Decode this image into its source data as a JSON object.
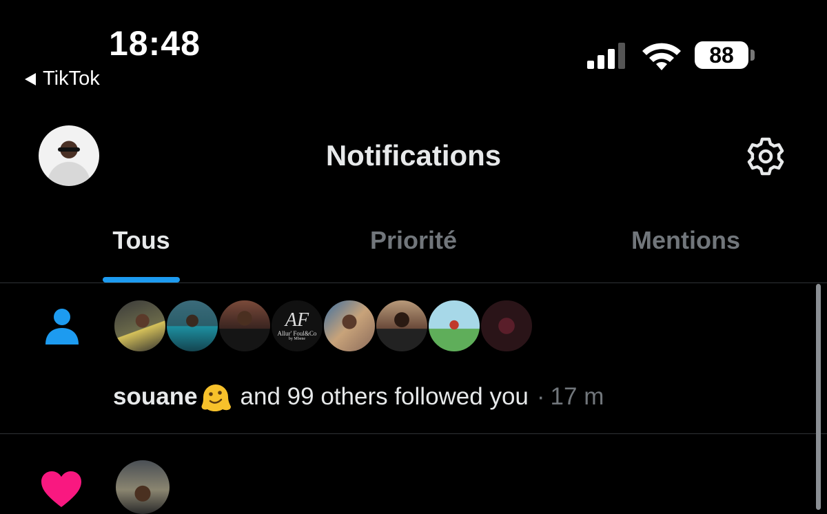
{
  "status_bar": {
    "time": "18:48",
    "back_app": "TikTok",
    "battery": "88"
  },
  "header": {
    "title": "Notifications",
    "settings_icon": "gear-icon"
  },
  "tabs": [
    {
      "label": "Tous",
      "active": true
    },
    {
      "label": "Priorité",
      "active": false
    },
    {
      "label": "Mentions",
      "active": false
    }
  ],
  "notifications": [
    {
      "type": "follow",
      "icon": "person-icon",
      "user": "souane",
      "text": "and 99 others followed you",
      "separator": "·",
      "time": "17 m",
      "avatar_text": {
        "monogram": "AF",
        "name": "Allur' Foul&Co",
        "by": "by Mbene"
      }
    },
    {
      "type": "like",
      "icon": "heart-icon"
    }
  ],
  "colors": {
    "accent": "#1d9bf0",
    "follow_icon": "#1d9bf0",
    "like_icon": "#f91880",
    "muted": "#71767b"
  }
}
